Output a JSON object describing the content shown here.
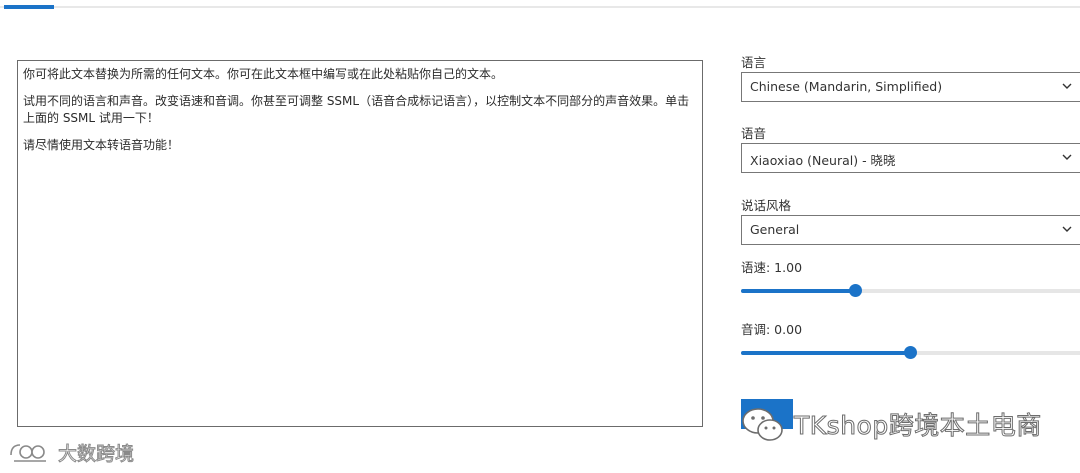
{
  "editor": {
    "paragraphs": [
      "你可将此文本替换为所需的任何文本。你可在此文本框中编写或在此处粘贴你自己的文本。",
      "试用不同的语言和声音。改变语速和音调。你甚至可调整 SSML（语音合成标记语言），以控制文本不同部分的声音效果。单击上面的 SSML 试用一下！",
      "请尽情使用文本转语音功能！"
    ]
  },
  "settings": {
    "language": {
      "label": "语言",
      "value": "Chinese (Mandarin, Simplified)"
    },
    "voice": {
      "label": "语音",
      "value": "Xiaoxiao (Neural) - 晓晓"
    },
    "style": {
      "label": "说话风格",
      "value": "General"
    },
    "rate": {
      "label": "语速: 1.00",
      "value": 1.0,
      "fill_fraction": 0.33
    },
    "pitch": {
      "label": "音调: 0.00",
      "value": 0.0,
      "fill_fraction": 0.49
    }
  },
  "watermarks": {
    "right": "TKshop跨境本土电商",
    "left": "大数跨境"
  },
  "colors": {
    "accent": "#1b73c8",
    "track": "#e6e6e6"
  },
  "icons": {
    "select_chevron": "chevron-down-icon",
    "wechat": "wechat-icon",
    "brand_logo": "brand-logo-icon"
  }
}
